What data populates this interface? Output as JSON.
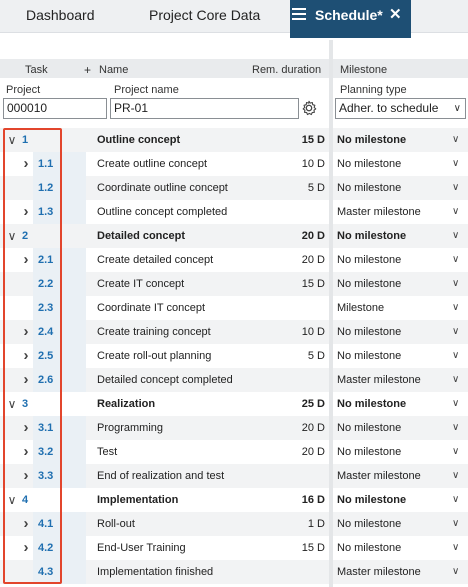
{
  "tabs": {
    "dashboard": "Dashboard",
    "core": "Project Core Data",
    "schedule": "Schedule*",
    "close_glyph": "✕"
  },
  "headers": {
    "task": "Task",
    "add": "+",
    "name": "Name",
    "rem_duration": "Rem. duration",
    "milestone": "Milestone",
    "project": "Project",
    "project_name": "Project name",
    "planning_type": "Planning type"
  },
  "filters": {
    "project_value": "000010",
    "project_name_value": "PR-01",
    "planning_type_value": "Adher. to schedule"
  },
  "colors": {
    "accent": "#1e4f74",
    "task_number": "#1f6fb0",
    "highlight": "#e2452c"
  },
  "rows": [
    {
      "num": "1",
      "name": "Outline concept",
      "dur": "15 D",
      "ms": "No milestone"
    },
    {
      "num": "1.1",
      "name": "Create outline concept",
      "dur": "10 D",
      "ms": "No milestone"
    },
    {
      "num": "1.2",
      "name": "Coordinate outline concept",
      "dur": "5 D",
      "ms": "No milestone"
    },
    {
      "num": "1.3",
      "name": "Outline concept completed",
      "dur": "",
      "ms": "Master milestone"
    },
    {
      "num": "2",
      "name": "Detailed concept",
      "dur": "20 D",
      "ms": "No milestone"
    },
    {
      "num": "2.1",
      "name": "Create detailed concept",
      "dur": "20 D",
      "ms": "No milestone"
    },
    {
      "num": "2.2",
      "name": "Create IT concept",
      "dur": "15 D",
      "ms": "No milestone"
    },
    {
      "num": "2.3",
      "name": "Coordinate IT concept",
      "dur": "",
      "ms": "Milestone"
    },
    {
      "num": "2.4",
      "name": "Create training concept",
      "dur": "10 D",
      "ms": "No milestone"
    },
    {
      "num": "2.5",
      "name": "Create roll-out planning",
      "dur": "5 D",
      "ms": "No milestone"
    },
    {
      "num": "2.6",
      "name": "Detailed concept completed",
      "dur": "",
      "ms": "Master milestone"
    },
    {
      "num": "3",
      "name": "Realization",
      "dur": "25 D",
      "ms": "No milestone"
    },
    {
      "num": "3.1",
      "name": "Programming",
      "dur": "20 D",
      "ms": "No milestone"
    },
    {
      "num": "3.2",
      "name": "Test",
      "dur": "20 D",
      "ms": "No milestone"
    },
    {
      "num": "3.3",
      "name": "End of realization and test",
      "dur": "",
      "ms": "Master milestone"
    },
    {
      "num": "4",
      "name": "Implementation",
      "dur": "16 D",
      "ms": "No milestone"
    },
    {
      "num": "4.1",
      "name": "Roll-out",
      "dur": "1 D",
      "ms": "No milestone"
    },
    {
      "num": "4.2",
      "name": "End-User Training",
      "dur": "15 D",
      "ms": "No milestone"
    },
    {
      "num": "4.3",
      "name": "Implementation finished",
      "dur": "",
      "ms": "Master milestone"
    }
  ]
}
